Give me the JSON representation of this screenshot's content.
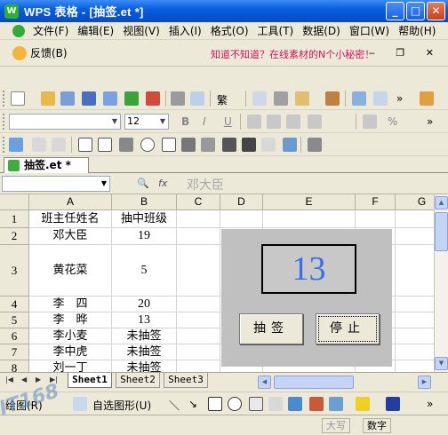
{
  "window": {
    "title": "WPS 表格 - [抽签.et *]",
    "app_icon": "W"
  },
  "menu": {
    "items": [
      "文件(F)",
      "编辑(E)",
      "视图(V)",
      "插入(I)",
      "格式(O)",
      "工具(T)",
      "数据(D)",
      "窗口(W)",
      "帮助(H)"
    ]
  },
  "feedback": {
    "label": "反馈(B)",
    "link": "知道不知道？在线素材的N个小秘密！"
  },
  "toolbar": {
    "traditional": "繁",
    "font_size": "12",
    "bold": "B",
    "italic": "I",
    "underline": "U",
    "percent": "%"
  },
  "doc_tab": {
    "label": "抽签.et *"
  },
  "formula": {
    "name_box": "",
    "content": "邓大臣"
  },
  "columns": [
    "A",
    "B",
    "C",
    "D",
    "E",
    "F",
    "G"
  ],
  "rows": [
    {
      "n": "1",
      "a": "班主任姓名",
      "b": "抽中班级"
    },
    {
      "n": "2",
      "a": "邓大臣",
      "b": "19"
    },
    {
      "n": "3",
      "a": "黄花菜",
      "b": "5"
    },
    {
      "n": "4",
      "a": "李　四",
      "b": "20"
    },
    {
      "n": "5",
      "a": "李　晔",
      "b": "13"
    },
    {
      "n": "6",
      "a": "李小麦",
      "b": "未抽签"
    },
    {
      "n": "7",
      "a": "李中虎",
      "b": "未抽签"
    },
    {
      "n": "8",
      "a": "刘一丁",
      "b": "未抽签"
    }
  ],
  "lottery": {
    "number": "13",
    "draw_button": "抽签",
    "stop_button": "停止"
  },
  "sheets": [
    "Sheet1",
    "Sheet2",
    "Sheet3"
  ],
  "drawbar": {
    "draw": "绘图(R)",
    "autoshape": "自选图形(U)"
  },
  "status": {
    "caps": "大写",
    "num": "数字"
  },
  "watermark": "IT168",
  "colors": {
    "titlebar": "#0a5fe0",
    "number": "#3a6ee8",
    "link": "#d2145a",
    "panel": "#c0c0c0"
  }
}
